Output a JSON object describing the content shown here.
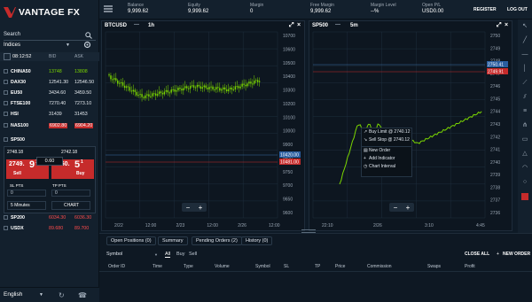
{
  "brand": {
    "name": "VANTAGE FX"
  },
  "sidebar": {
    "search_label": "Search",
    "category": "Indices",
    "clock": "08:12:52",
    "col_bid": "BID",
    "col_ask": "ASK",
    "rows": [
      {
        "sym": "CHINA50",
        "bid": "13748",
        "ask": "13808",
        "dir": "up"
      },
      {
        "sym": "DAX30",
        "bid": "12541.30",
        "ask": "12546.50",
        "dir": "wt"
      },
      {
        "sym": "EU50",
        "bid": "3434.60",
        "ask": "3459.50",
        "dir": "wt"
      },
      {
        "sym": "FTSE100",
        "bid": "7270.40",
        "ask": "7273.10",
        "dir": "wt"
      },
      {
        "sym": "HSI",
        "bid": "31439",
        "ask": "31453",
        "dir": "wt"
      },
      {
        "sym": "NAS100",
        "bid": "6902.80",
        "ask": "6904.20",
        "dir": "dn"
      },
      {
        "sym": "SP500",
        "bid": "",
        "ask": "",
        "dir": "wt",
        "active": true
      },
      {
        "sym": "SP200",
        "bid": "6034.30",
        "ask": "6036.30",
        "dir": "dn"
      },
      {
        "sym": "USDX",
        "bid": "89.680",
        "ask": "89.700",
        "dir": "dn"
      }
    ],
    "trade": {
      "low": "2748.18",
      "high": "2742.18",
      "sell_price": "2749.",
      "sell_big": "9",
      "sell_sup": "1",
      "sell_label": "Sell",
      "buy_price": "2750.",
      "buy_big": "5",
      "buy_sup": "1",
      "buy_label": "Buy",
      "lots": "0.60",
      "sl_label": "SL PTS",
      "tp_label": "TP PTS",
      "sl_val": "0",
      "tp_val": "0",
      "expiry": "5 Minutes",
      "chart_btn": "CHART"
    },
    "language": "English"
  },
  "topbar": {
    "stats": [
      {
        "label": "Balance",
        "value": "9,999.62"
      },
      {
        "label": "Equity",
        "value": "9,999.62"
      },
      {
        "label": "Margin",
        "value": "0"
      },
      {
        "label": "Free Margin",
        "value": "9,999.62"
      },
      {
        "label": "Margin Level",
        "value": "--%"
      },
      {
        "label": "Open P/L",
        "value": "USD0.00"
      }
    ],
    "register": "REGISTER",
    "logout": "LOG OUT"
  },
  "charts": [
    {
      "symbol": "BTCUSD",
      "timeframe": "1h",
      "price_tags": [
        "10420.00",
        "10481.00"
      ],
      "y_ticks": [
        "10700",
        "10600",
        "10500",
        "10400",
        "10300",
        "10200",
        "10100",
        "10000",
        "9900",
        "9800",
        "9750",
        "9700",
        "9650",
        "9600"
      ],
      "x_ticks": [
        "2/22",
        "12:00",
        "2/23",
        "12:00",
        "2/26",
        "12:00"
      ]
    },
    {
      "symbol": "SP500",
      "timeframe": "5m",
      "price_tags": [
        "2750.41",
        "2749.91"
      ],
      "y_ticks": [
        "2750",
        "2749",
        "2748",
        "2747",
        "2746",
        "2745",
        "2744",
        "2743",
        "2742",
        "2741",
        "2740",
        "2739",
        "2738",
        "2737",
        "2736"
      ],
      "x_ticks": [
        "22:10",
        "2/26",
        "3:10",
        "4:45"
      ]
    }
  ],
  "context_menu": {
    "items": [
      "Buy Limit @ 2740.12",
      "Sell Stop @ 2740.12",
      "New Order",
      "Add Indicator",
      "Chart Interval"
    ]
  },
  "bottom": {
    "tabs": [
      "Open Positions (0)",
      "Summary",
      "Pending Orders (2)",
      "History (0)"
    ],
    "symbol_label": "Symbol",
    "filters": [
      "All",
      "Buy",
      "Sell"
    ],
    "close_all": "CLOSE ALL",
    "new_order": "NEW ORDER",
    "columns": [
      "Order ID",
      "Time",
      "Type",
      "Volume",
      "Symbol",
      "SL",
      "TP",
      "Price",
      "Commission",
      "Swaps",
      "Profit"
    ]
  },
  "colors": {
    "accent_red": "#c62b2b",
    "up_green": "#7bd700",
    "down_red": "#ff4c4c",
    "bg": "#0e1a26"
  }
}
